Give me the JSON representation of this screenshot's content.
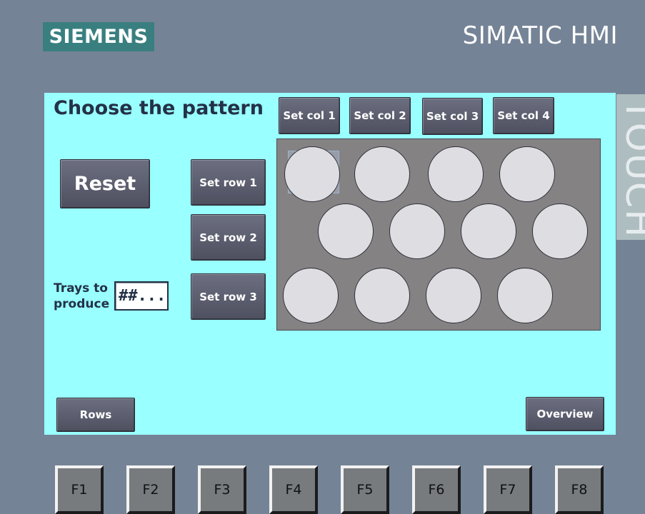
{
  "header": {
    "brand": "SIEMENS",
    "product": "SIMATIC HMI",
    "side_label": "TOUCH"
  },
  "screen": {
    "title": "Choose the pattern",
    "reset_label": "Reset",
    "col_buttons": [
      "Set col 1",
      "Set col 2",
      "Set col 3",
      "Set col 4"
    ],
    "row_buttons": [
      "Set row 1",
      "Set row 2",
      "Set row 3"
    ],
    "trays_label_line1": "Trays to",
    "trays_label_line2": "produce",
    "trays_value": "##...",
    "rows_button": "Rows",
    "overview_button": "Overview"
  },
  "tray": {
    "rows": [
      {
        "row": 1,
        "wells": 4
      },
      {
        "row": 2,
        "wells": 4
      },
      {
        "row": 3,
        "wells": 4
      }
    ]
  },
  "function_keys": [
    "F1",
    "F2",
    "F3",
    "F4",
    "F5",
    "F6",
    "F7",
    "F8"
  ],
  "colors": {
    "bezel": "#758396",
    "screen_bg": "#99ffff",
    "brand_bg": "#3a7f80",
    "button": "#5b5d6d",
    "tray": "#858284",
    "well": "#dedde2",
    "text_dark": "#233147"
  }
}
